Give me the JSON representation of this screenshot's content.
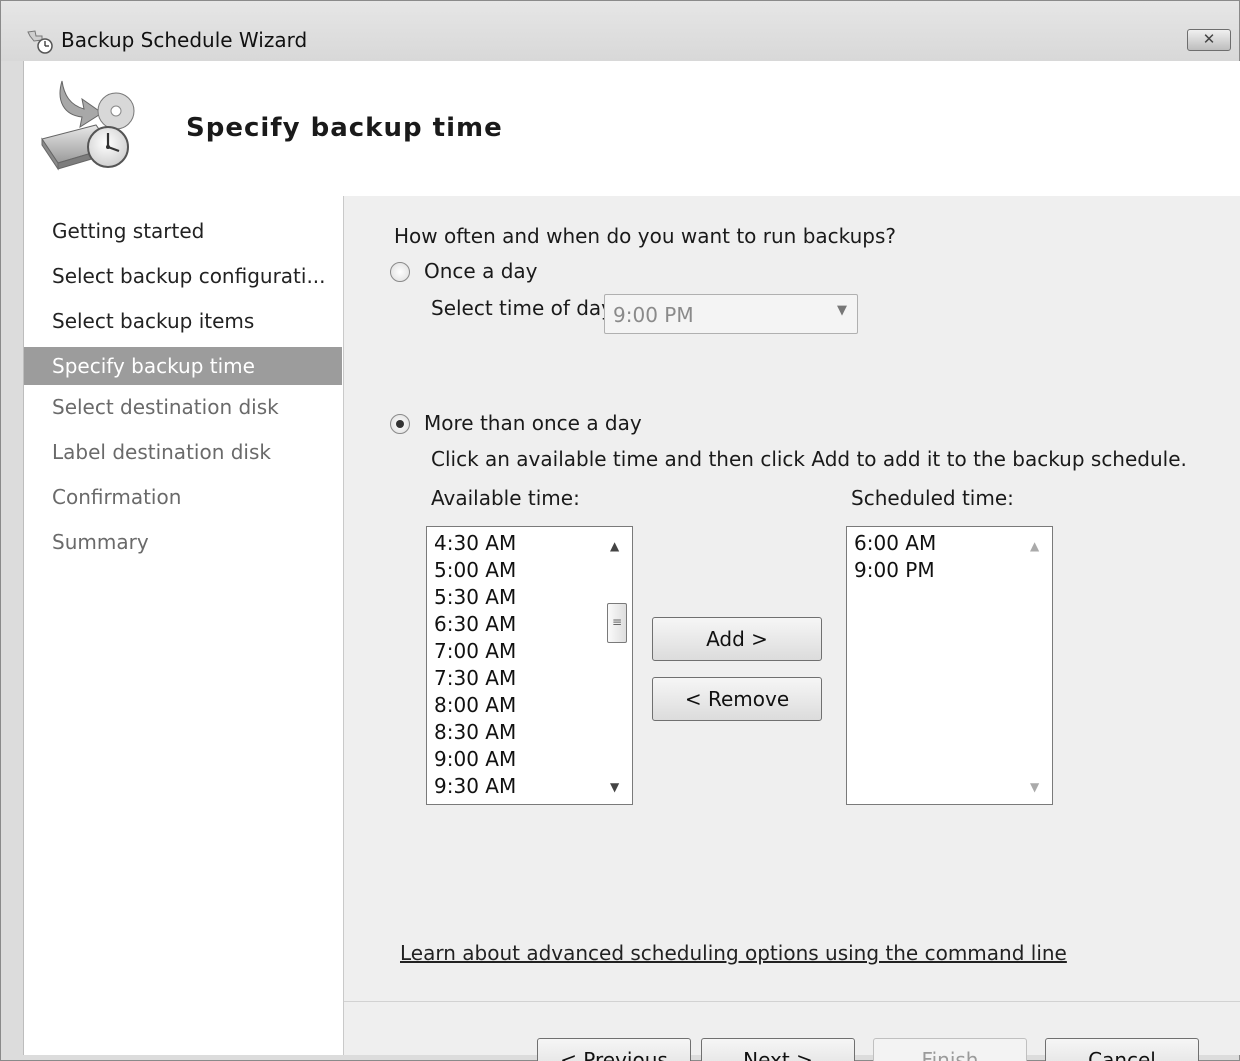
{
  "window": {
    "title": "Backup Schedule Wizard",
    "close_glyph": "✕"
  },
  "header": {
    "page_title": "Specify backup time"
  },
  "nav": {
    "items": [
      {
        "label": "Getting started",
        "state": "done"
      },
      {
        "label": "Select backup configurati...",
        "state": "done"
      },
      {
        "label": "Select backup items",
        "state": "done"
      },
      {
        "label": "Specify backup time",
        "state": "active"
      },
      {
        "label": "Select destination disk",
        "state": "pending"
      },
      {
        "label": "Label destination disk",
        "state": "pending"
      },
      {
        "label": "Confirmation",
        "state": "pending"
      },
      {
        "label": "Summary",
        "state": "pending"
      }
    ]
  },
  "main": {
    "question": "How often and when do you want to run backups?",
    "once_a_day": {
      "label": "Once a day",
      "checked": false,
      "time_label": "Select time of day:",
      "time_value": "9:00 PM"
    },
    "more_than_once": {
      "label": "More than once a day",
      "checked": true,
      "instructions": "Click an available time and then click Add to add it to the backup schedule."
    },
    "available": {
      "label": "Available time:",
      "items": [
        "4:30 AM",
        "5:00 AM",
        "5:30 AM",
        "6:30 AM",
        "7:00 AM",
        "7:30 AM",
        "8:00 AM",
        "8:30 AM",
        "9:00 AM",
        "9:30 AM"
      ]
    },
    "scheduled": {
      "label": "Scheduled time:",
      "items": [
        "6:00 AM",
        "9:00 PM"
      ]
    },
    "add_label": "Add >",
    "remove_label": "< Remove",
    "learn_link": "Learn about advanced scheduling options using the command line"
  },
  "footer": {
    "previous_label": "< Previous",
    "next_label": "Next >",
    "finish_label": "Finish",
    "cancel_label": "Cancel"
  },
  "icons": {
    "title": "backup-clock-icon",
    "header": "backup-disk-clock-icon",
    "scroll_up": "▲",
    "scroll_down": "▼",
    "dropdown": "▼",
    "scroll_grip": "≡"
  }
}
